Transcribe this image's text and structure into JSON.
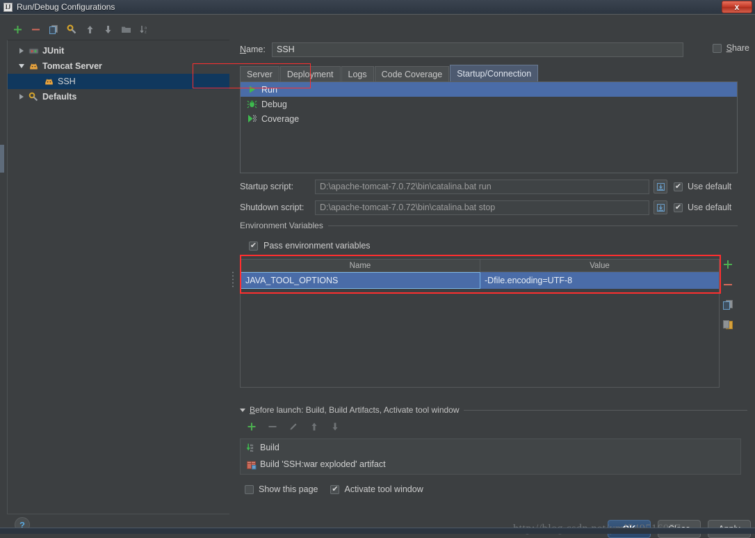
{
  "window": {
    "title": "Run/Debug Configurations",
    "app_icon": "IJ",
    "close_label": "x"
  },
  "left_panel": {
    "toolbar": [
      {
        "name": "add-icon",
        "glyph": "+"
      },
      {
        "name": "remove-icon",
        "glyph": "−"
      },
      {
        "name": "copy-icon",
        "glyph": "copy"
      },
      {
        "name": "edit-defaults-icon",
        "glyph": "wrench"
      },
      {
        "name": "move-up-icon",
        "glyph": "↑"
      },
      {
        "name": "move-down-icon",
        "glyph": "↓"
      },
      {
        "name": "folder-icon",
        "glyph": "folder"
      },
      {
        "name": "sort-alphabetically-icon",
        "glyph": "sort"
      }
    ],
    "tree": [
      {
        "label": "JUnit",
        "icon": "junit-icon",
        "expanded": false,
        "level": 0,
        "selected": false,
        "bold": true
      },
      {
        "label": "Tomcat Server",
        "icon": "tomcat-icon",
        "expanded": true,
        "level": 0,
        "selected": false,
        "bold": true
      },
      {
        "label": "SSH",
        "icon": "tomcat-icon",
        "expanded": null,
        "level": 1,
        "selected": true,
        "bold": false
      },
      {
        "label": "Defaults",
        "icon": "defaults-icon",
        "expanded": false,
        "level": 0,
        "selected": false,
        "bold": true
      }
    ]
  },
  "right_panel": {
    "name_label": "Name:",
    "name_value": "SSH",
    "share_label": "Share",
    "share_checked": false,
    "tabs": [
      {
        "label": "Server",
        "active": false
      },
      {
        "label": "Deployment",
        "active": false
      },
      {
        "label": "Logs",
        "active": false
      },
      {
        "label": "Code Coverage",
        "active": false
      },
      {
        "label": "Startup/Connection",
        "active": true
      }
    ],
    "run_modes": [
      {
        "label": "Run",
        "icon": "run-icon",
        "selected": true
      },
      {
        "label": "Debug",
        "icon": "debug-icon",
        "selected": false
      },
      {
        "label": "Coverage",
        "icon": "coverage-icon",
        "selected": false
      }
    ],
    "startup": {
      "label": "Startup script:",
      "value": "D:\\apache-tomcat-7.0.72\\bin\\catalina.bat run",
      "browse_icon": "insert-variable-icon",
      "use_default_label": "Use default",
      "use_default_checked": true
    },
    "shutdown": {
      "label": "Shutdown script:",
      "value": "D:\\apache-tomcat-7.0.72\\bin\\catalina.bat stop",
      "browse_icon": "insert-variable-icon",
      "use_default_label": "Use default",
      "use_default_checked": true
    },
    "environment": {
      "group_title": "Environment Variables",
      "pass_env_label": "Pass environment variables",
      "pass_env_checked": true,
      "columns": [
        "Name",
        "Value"
      ],
      "rows": [
        {
          "name": "JAVA_TOOL_OPTIONS",
          "value": "-Dfile.encoding=UTF-8",
          "selected": true
        }
      ],
      "side_buttons": [
        {
          "name": "add-env-icon",
          "glyph": "+"
        },
        {
          "name": "remove-env-icon",
          "glyph": "−"
        },
        {
          "name": "copy-env-icon",
          "glyph": "copy"
        },
        {
          "name": "paste-env-icon",
          "glyph": "paste"
        }
      ]
    },
    "before_launch": {
      "title": "Before launch: Build, Build Artifacts, Activate tool window",
      "toolbar": [
        {
          "name": "add-task-icon",
          "glyph": "+"
        },
        {
          "name": "remove-task-icon",
          "glyph": "−"
        },
        {
          "name": "edit-task-icon",
          "glyph": "pencil"
        },
        {
          "name": "task-up-icon",
          "glyph": "↑"
        },
        {
          "name": "task-down-icon",
          "glyph": "↓"
        }
      ],
      "tasks": [
        {
          "label": "Build",
          "icon": "build-icon"
        },
        {
          "label": "Build 'SSH:war exploded' artifact",
          "icon": "artifact-icon"
        }
      ]
    },
    "bottom_options": [
      {
        "label": "Show this page",
        "checked": false,
        "name": "show-this-page-checkbox"
      },
      {
        "label": "Activate tool window",
        "checked": true,
        "name": "activate-tool-window-checkbox"
      }
    ]
  },
  "footer": {
    "help_glyph": "?",
    "buttons": [
      {
        "label": "OK",
        "primary": true,
        "name": "ok-button"
      },
      {
        "label": "Close",
        "primary": false,
        "name": "close-button"
      },
      {
        "label": "Apply",
        "primary": false,
        "name": "apply-button"
      }
    ]
  },
  "watermark": "http://blog.csdn.net/yml549516057",
  "colors": {
    "dialog_bg": "#3c3f41",
    "selection_blue": "#4a6ca8",
    "tree_selection": "#10385e",
    "accent_green": "#3fba4f",
    "highlight_red": "#ff2f2f",
    "title_bar": "#2f3a44"
  }
}
